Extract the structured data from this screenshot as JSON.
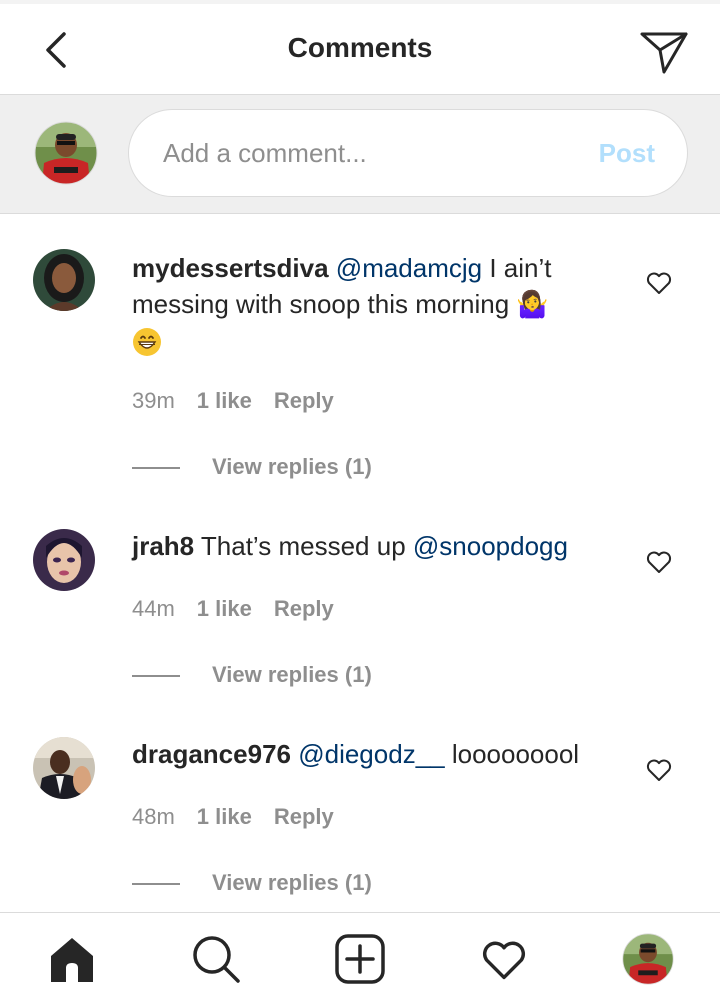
{
  "header": {
    "title": "Comments",
    "back_icon": "chevron-left-icon",
    "send_icon": "paper-plane-icon"
  },
  "composer": {
    "placeholder": "Add a comment...",
    "post_label": "Post",
    "post_color": "#b2dffc"
  },
  "comments": [
    {
      "username": "mydessertsdiva",
      "mention": "@madamcjg",
      "text": " I ain’t messing with snoop this morning 🤷‍♀",
      "emoji": "grinning-face-emoji",
      "time": "39m",
      "likes": "1 like",
      "reply_label": "Reply",
      "view_replies": "View replies (1)"
    },
    {
      "username": "jrah8",
      "text_before": " That’s messed up ",
      "mention": "@snoopdogg",
      "time": "44m",
      "likes": "1 like",
      "reply_label": "Reply",
      "view_replies": "View replies (1)"
    },
    {
      "username": "dragance976",
      "mention": "@diegodz__",
      "text": " looooooool",
      "time": "48m",
      "likes": "1 like",
      "reply_label": "Reply",
      "view_replies": "View replies (1)"
    }
  ],
  "bottom_nav": {
    "items": [
      "home-icon",
      "search-icon",
      "new-post-icon",
      "activity-heart-icon",
      "profile-avatar"
    ]
  },
  "colors": {
    "mention": "#003569",
    "secondary_text": "#8e8e8e",
    "primary_text": "#262626"
  }
}
